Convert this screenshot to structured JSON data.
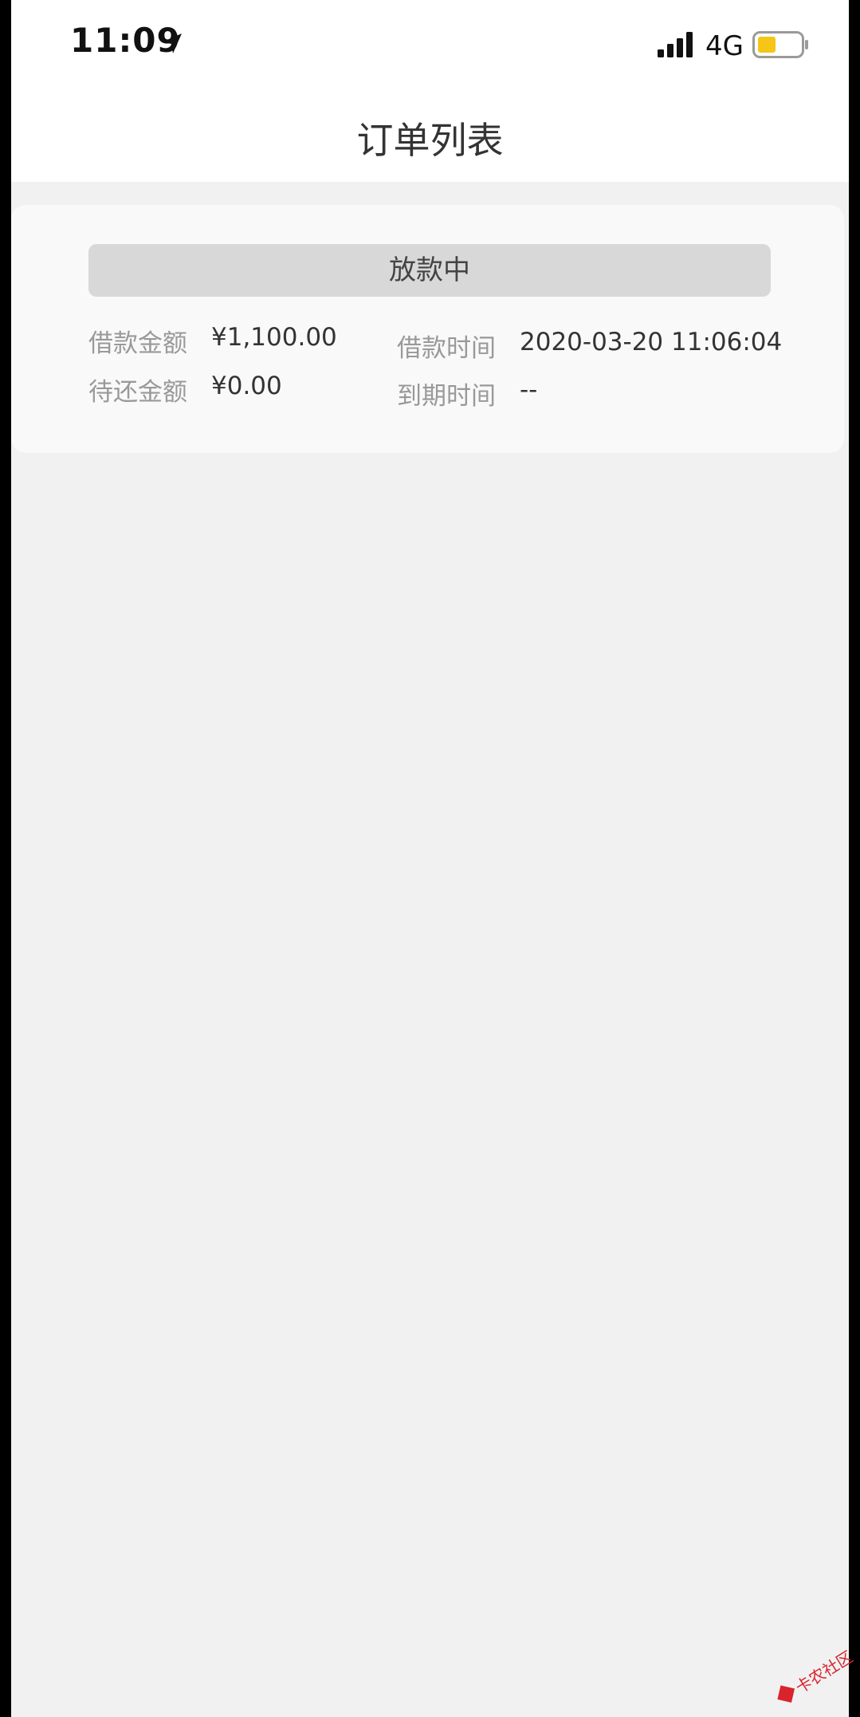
{
  "status_bar": {
    "time": "11:09",
    "network": "4G",
    "battery_color": "#f5c518"
  },
  "header": {
    "title": "订单列表"
  },
  "order": {
    "status": "放款中",
    "loan_amount_label": "借款金额",
    "loan_amount": "¥1,100.00",
    "pending_amount_label": "待还金额",
    "pending_amount": "¥0.00",
    "loan_time_label": "借款时间",
    "loan_time": "2020-03-20 11:06:04",
    "due_time_label": "到期时间",
    "due_time": "--"
  },
  "watermark": {
    "text": "卡农社区",
    "color": "#d9232d"
  },
  "icons": [
    "location-arrow-icon",
    "cellular-signal-icon",
    "battery-icon"
  ]
}
